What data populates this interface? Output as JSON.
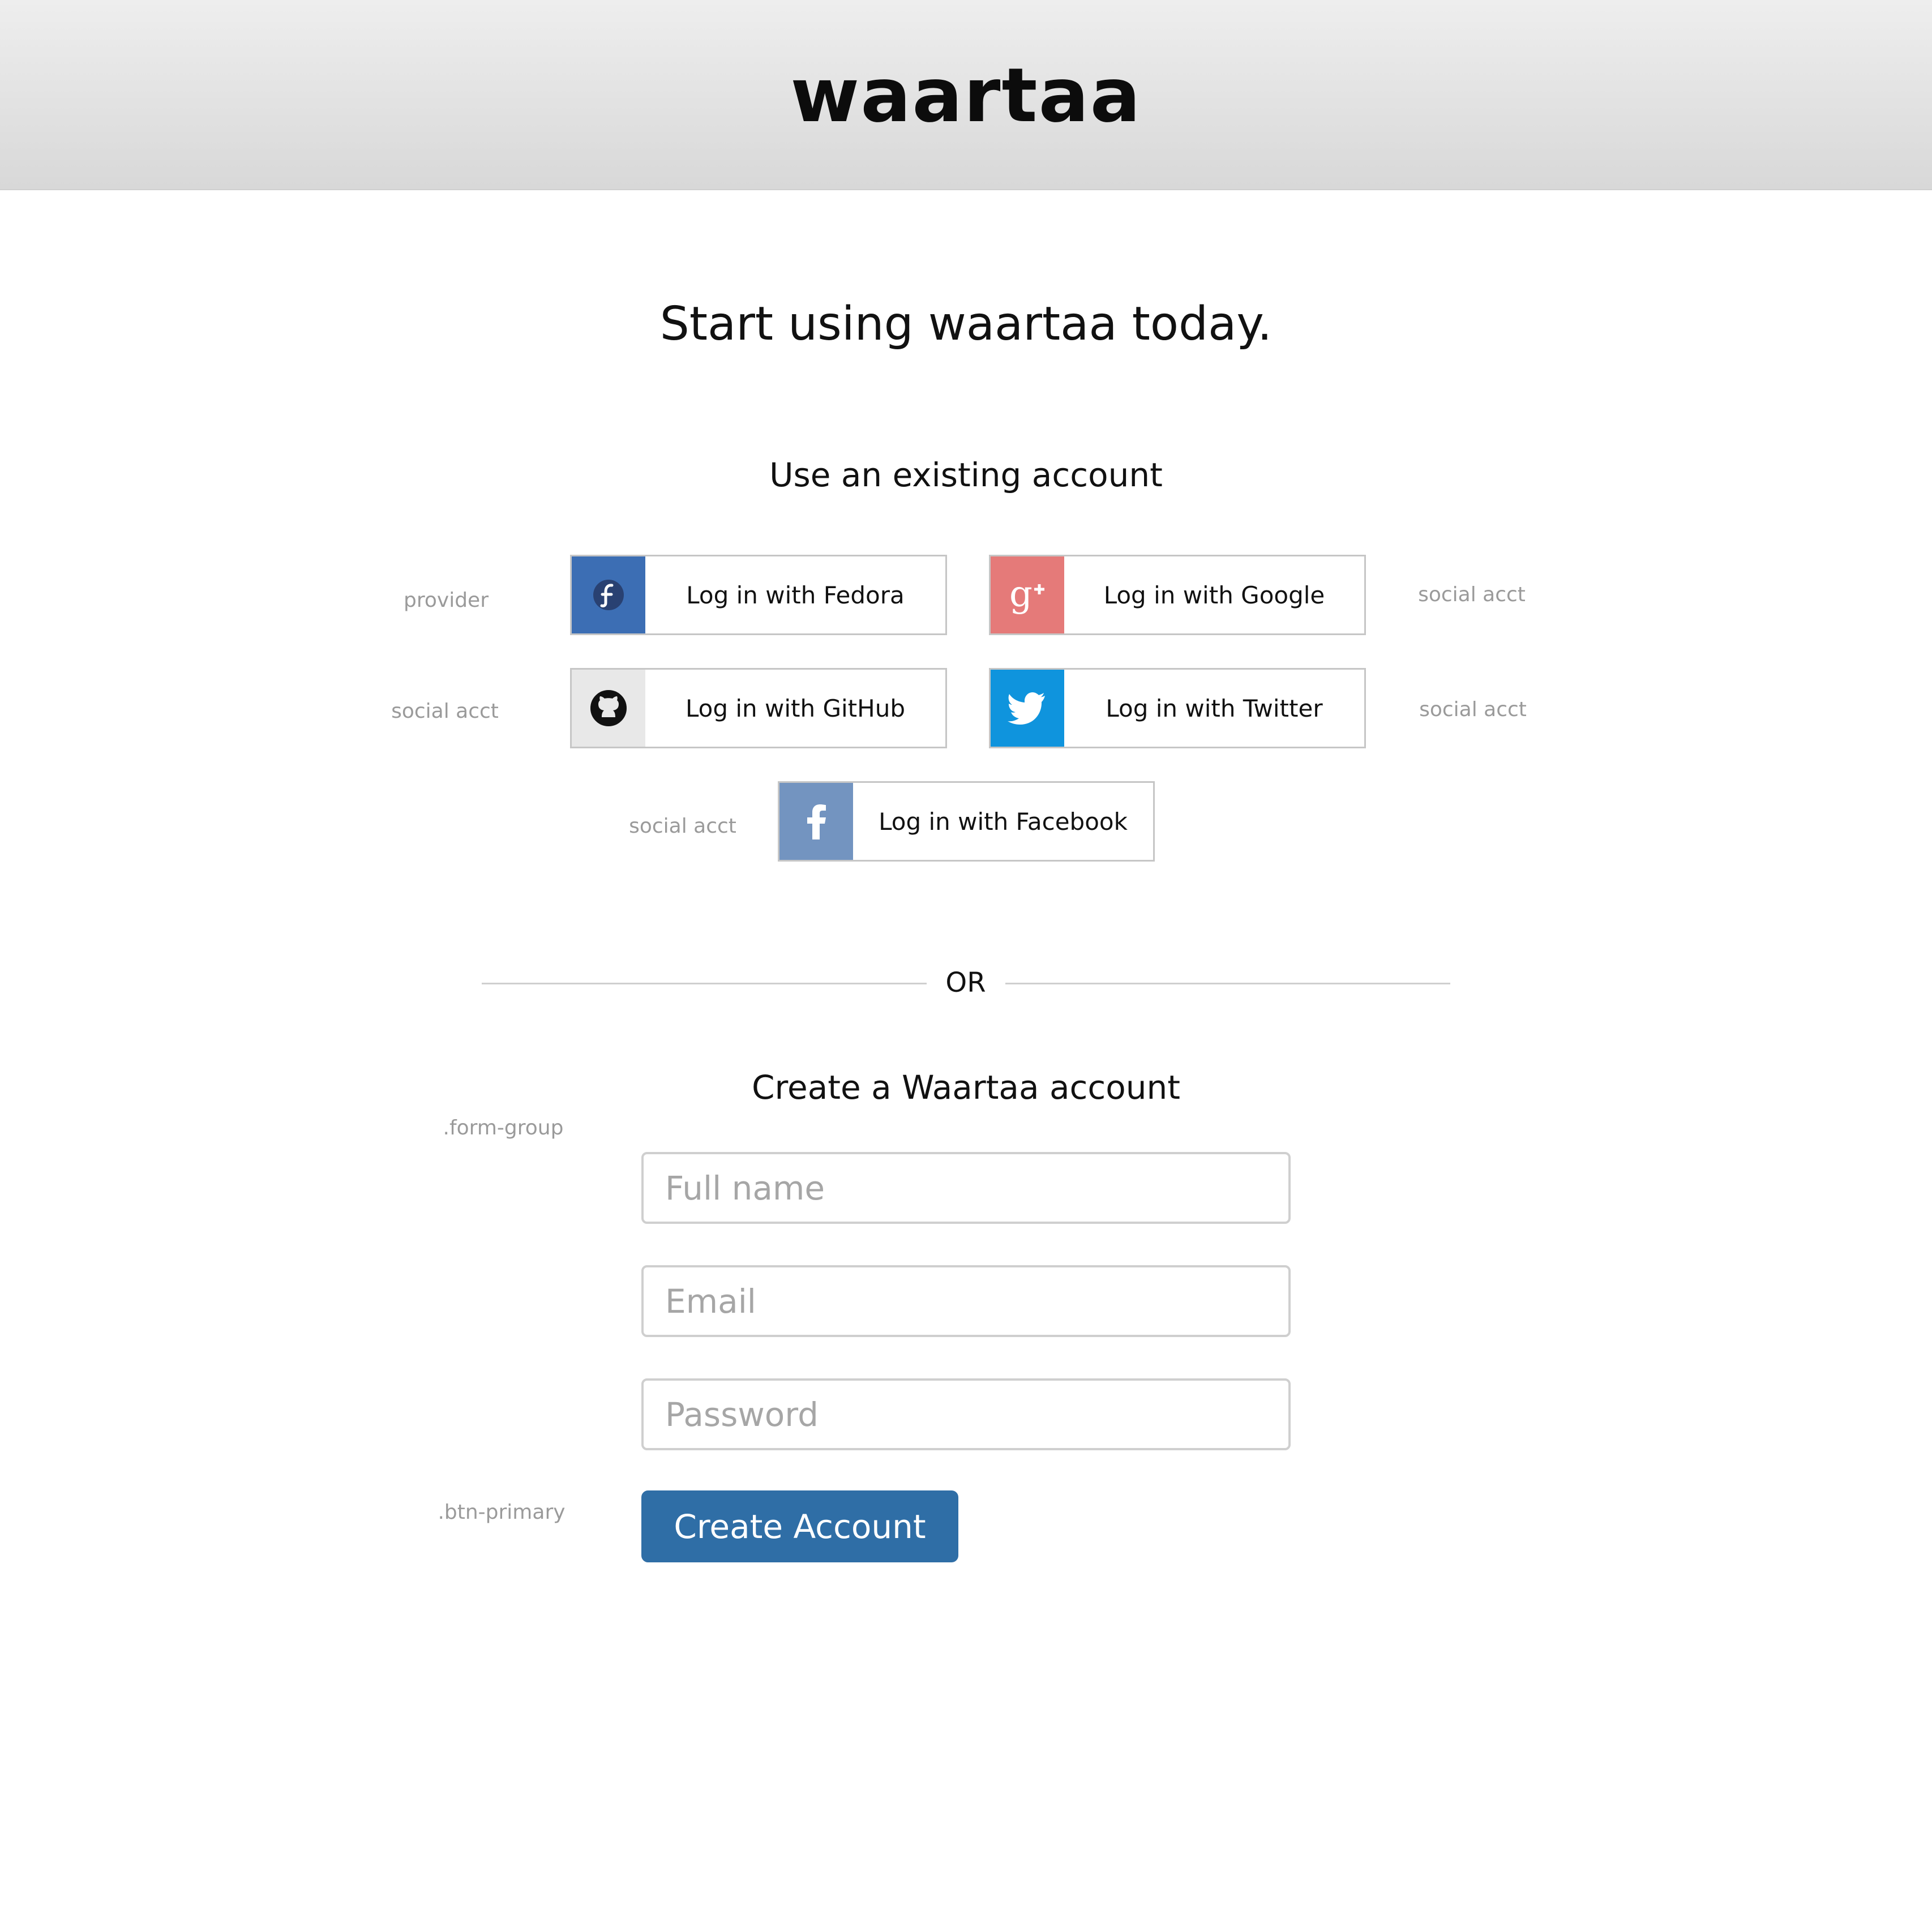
{
  "header": {
    "brand": "waartaa"
  },
  "page": {
    "title": "Start using waartaa today."
  },
  "social": {
    "title": "Use an existing account",
    "buttons": [
      {
        "label": "Log in with Fedora",
        "icon": "fedora-icon",
        "color": "#3c6eb4"
      },
      {
        "label": "Log in with Google",
        "icon": "google-plus-icon",
        "color": "#e57a79"
      },
      {
        "label": "Log in with GitHub",
        "icon": "github-icon",
        "color": "#e8e8e8"
      },
      {
        "label": "Log in with Twitter",
        "icon": "twitter-icon",
        "color": "#0f94dd"
      },
      {
        "label": "Log in with Facebook",
        "icon": "facebook-icon",
        "color": "#7394c0"
      }
    ],
    "annotations": {
      "provider": "provider",
      "social_acct": "social acct"
    }
  },
  "divider": {
    "text": "OR"
  },
  "signup": {
    "title": "Create a Waartaa account",
    "annotation_form_group": ".form-group",
    "annotation_btn": ".btn-primary",
    "fields": {
      "full_name_placeholder": "Full name",
      "email_placeholder": "Email",
      "password_placeholder": "Password"
    },
    "submit_label": "Create Account"
  },
  "colors": {
    "primary": "#2f6ea6",
    "border": "#c6c6c6",
    "annotation": "#9a9a9a"
  }
}
